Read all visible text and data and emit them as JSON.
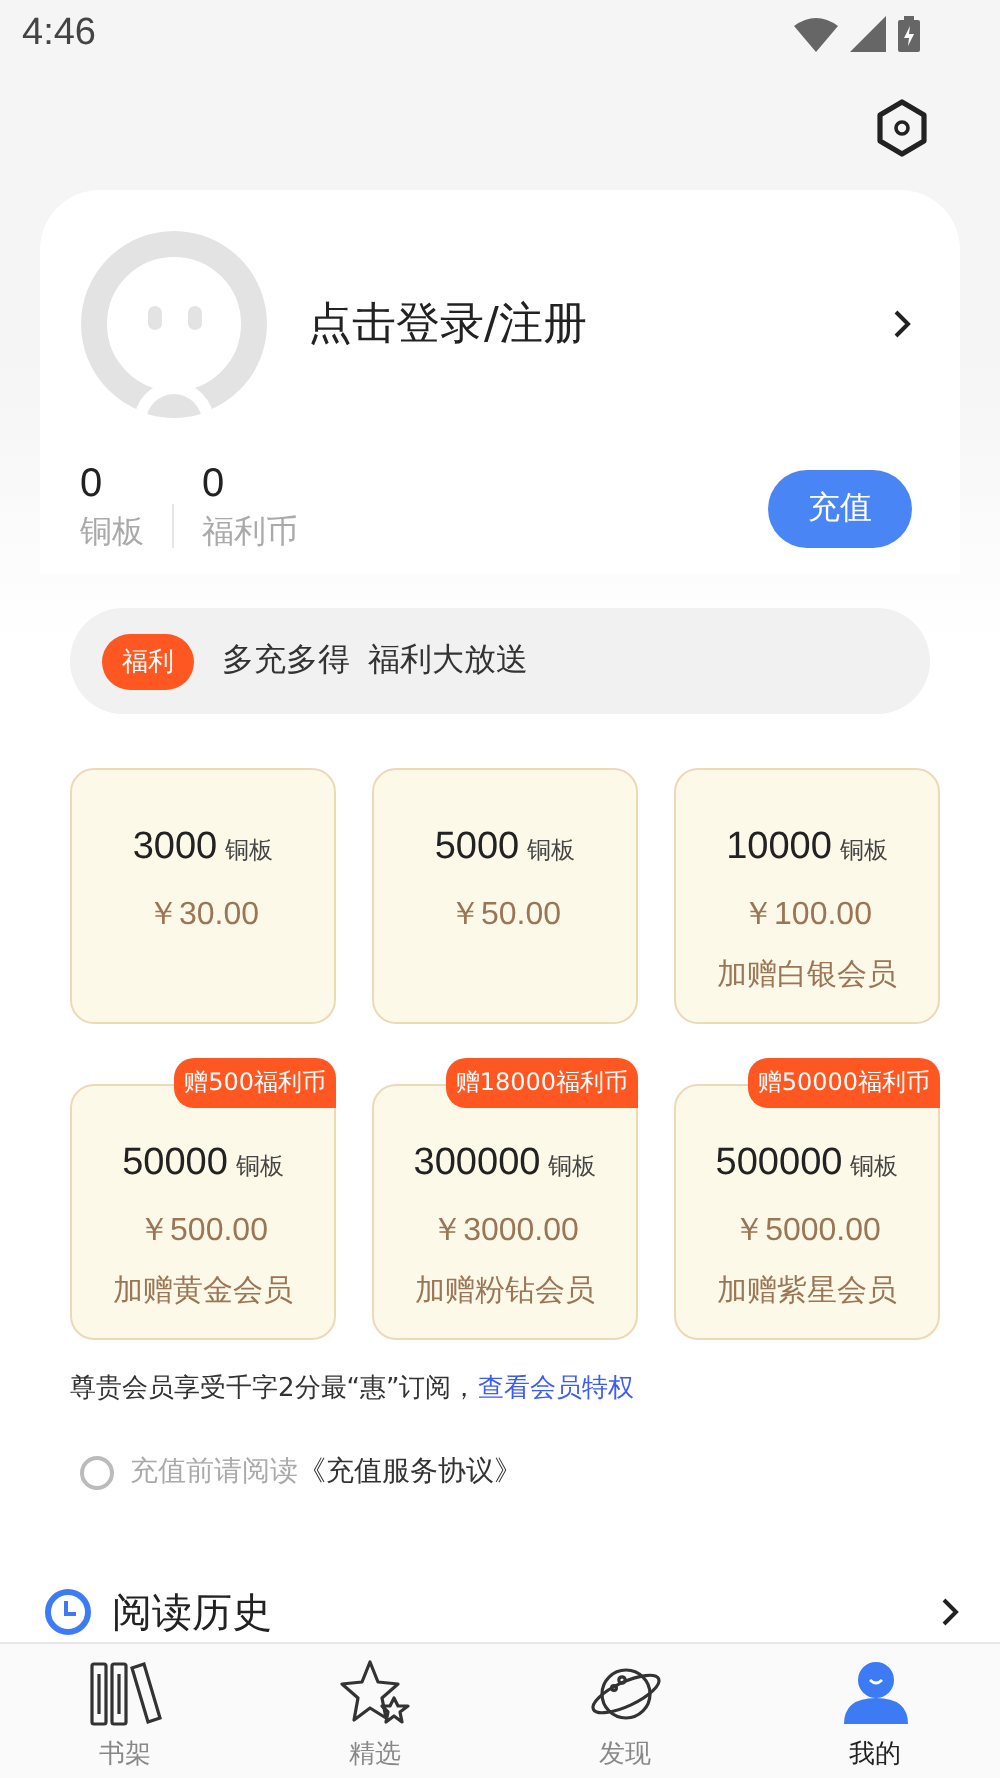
{
  "status_bar": {
    "time": "4:46"
  },
  "account": {
    "login_text": "点击登录/注册",
    "stats": [
      {
        "value": "0",
        "label": "铜板"
      },
      {
        "value": "0",
        "label": "福利币"
      }
    ],
    "recharge_button": "充值"
  },
  "promo": {
    "tag": "福利",
    "text": "多充多得 福利大放送"
  },
  "packages": [
    {
      "amount": "3000",
      "unit": "铜板",
      "price": "￥30.00"
    },
    {
      "amount": "5000",
      "unit": "铜板",
      "price": "￥50.00"
    },
    {
      "amount": "10000",
      "unit": "铜板",
      "price": "￥100.00",
      "bonus": "加赠白银会员"
    },
    {
      "amount": "50000",
      "unit": "铜板",
      "price": "￥500.00",
      "bonus": "加赠黄金会员",
      "badge": "赠500福利币"
    },
    {
      "amount": "300000",
      "unit": "铜板",
      "price": "￥3000.00",
      "bonus": "加赠粉钻会员",
      "badge": "赠18000福利币"
    },
    {
      "amount": "500000",
      "unit": "铜板",
      "price": "￥5000.00",
      "bonus": "加赠紫星会员",
      "badge": "赠50000福利币"
    }
  ],
  "member_note": {
    "text": "尊贵会员享受千字2分最“惠”订阅，",
    "link": "查看会员特权"
  },
  "agreement": {
    "checked": false,
    "text": "充值前请阅读",
    "link": "《充值服务协议》"
  },
  "history": {
    "label": "阅读历史"
  },
  "nav": [
    {
      "kind": "shelf",
      "label": "书架",
      "selected": false
    },
    {
      "kind": "star",
      "label": "精选",
      "selected": false
    },
    {
      "kind": "planet",
      "label": "发现",
      "selected": false
    },
    {
      "kind": "person",
      "label": "我的",
      "selected": true
    }
  ]
}
